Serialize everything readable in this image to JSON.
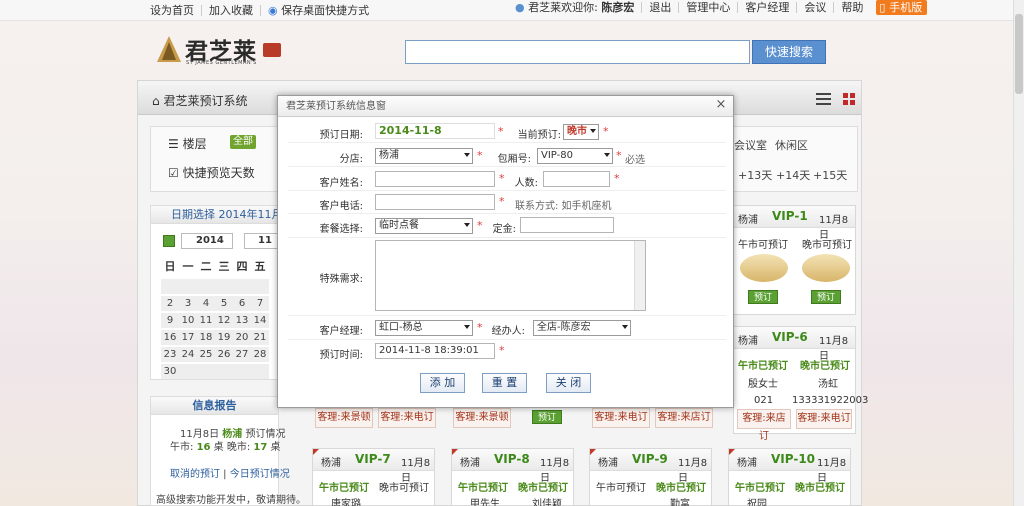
{
  "topbar": {
    "set_home": "设为首页",
    "add_fav": "加入收藏",
    "save_shortcut": "保存桌面快捷方式",
    "welcome": "君芝莱欢迎你:",
    "user": "陈彦宏",
    "logout": "退出",
    "admin": "管理中心",
    "customer_manager": "客户经理",
    "meeting": "会议",
    "help": "帮助",
    "mobile": "手机版"
  },
  "header": {
    "logo_text": "君芝莱",
    "logo_sub": "ST JAMES GENTLEMAN'S",
    "search_value": "",
    "search_button": "快速搜索"
  },
  "nav": {
    "title": "君芝莱预订系统"
  },
  "filter": {
    "floor_label": "楼层",
    "all_badge": "全部",
    "quick_days_label": "快捷预览天数",
    "area_items": [
      "会议室",
      "休闲区"
    ],
    "day_items": [
      "+13天",
      "+14天",
      "+15天"
    ]
  },
  "calendar": {
    "title": "日期选择 2014年11月8日",
    "year": "2014",
    "month": "11",
    "weekdays": [
      "日",
      "一",
      "二",
      "三",
      "四",
      "五"
    ],
    "rows": [
      [
        "",
        "",
        "",
        "",
        "",
        ""
      ],
      [
        "2",
        "3",
        "4",
        "5",
        "6",
        "7"
      ],
      [
        "9",
        "10",
        "11",
        "12",
        "13",
        "14"
      ],
      [
        "16",
        "17",
        "18",
        "19",
        "20",
        "21"
      ],
      [
        "23",
        "24",
        "25",
        "26",
        "27",
        "28"
      ],
      [
        "30",
        "",
        "",
        "",
        "",
        ""
      ]
    ]
  },
  "info": {
    "title": "信息报告",
    "line1_date": "11月8日",
    "line1_branch": "杨浦",
    "line1_suffix": "预订情况",
    "lunch_label": "午市:",
    "lunch_count": "16",
    "table_unit1": "桌",
    "dinner_label": "晚市:",
    "dinner_count": "17",
    "table_unit2": "桌",
    "cancelled_link": "取消的预订",
    "today_link": "今日预订情况",
    "advanced": "高级搜索功能开发中，敬请期待。"
  },
  "cards": [
    {
      "name": "VIP-1",
      "date": "11月8日",
      "loc": "杨浦",
      "lunch": "午市可预订",
      "dinner": "晚市可预订",
      "book1": "预订",
      "book2": "预订"
    },
    {
      "name": "VIP-6",
      "date": "11月8日",
      "loc": "杨浦",
      "lunch": "午市已预订",
      "dinner": "晚市已预订",
      "lunch_guest": "殷女士",
      "dinner_guest": "汤虹",
      "lunch_phone": "021",
      "dinner_phone": "133331922003",
      "foot1": "客理:来店订",
      "foot2": "客理:来电订"
    },
    {
      "name": "VIP-7",
      "date": "11月8日",
      "loc": "杨浦",
      "lunch": "午市已预订",
      "dinner": "晚市可预订",
      "lunch_guest": "唐家璐"
    },
    {
      "name": "VIP-8",
      "date": "11月8日",
      "loc": "杨浦",
      "lunch": "午市已预订",
      "dinner": "晚市已预订",
      "lunch_guest": "甲先生",
      "dinner_guest": "刘佳颖"
    },
    {
      "name": "VIP-9",
      "date": "11月8日",
      "loc": "杨浦",
      "lunch": "午市可预订",
      "dinner": "晚市已预订",
      "dinner_guest": "勤富"
    },
    {
      "name": "VIP-10",
      "date": "11月8日",
      "loc": "杨浦",
      "lunch": "午市已预订",
      "dinner": "晚市已预订",
      "lunch_guest": "祝园"
    }
  ],
  "row2_footers": [
    "客理:来景顿",
    "客理:来电订",
    "客理:来景顿",
    "预订",
    "客理:来电订",
    "客理:来店订",
    "客理:来电订"
  ],
  "dialog": {
    "title": "君芝莱预订系统信息窗",
    "close": "×",
    "date_label": "预订日期:",
    "date_value": "2014-11-8",
    "current_label": "当前预订:",
    "current_value": "晚市",
    "branch_label": "分店:",
    "branch_value": "杨浦",
    "room_label": "包厢号:",
    "room_value": "VIP-80",
    "required": "必选",
    "name_label": "客户姓名:",
    "name_value": "",
    "people_label": "人数:",
    "people_value": "",
    "phone_label": "客户电话:",
    "phone_value": "",
    "contact_hint": "联系方式: 如手机座机",
    "meal_label": "套餐选择:",
    "meal_value": "临时点餐",
    "deposit_label": "定金:",
    "deposit_value": "",
    "special_label": "特殊需求:",
    "special_value": "",
    "manager_label": "客户经理:",
    "manager_value": "虹口-杨总",
    "handler_label": "经办人:",
    "handler_value": "全店-陈彦宏",
    "time_label": "预订时间:",
    "time_value": "2014-11-8 18:39:01",
    "add_btn": "添 加",
    "reset_btn": "重 置",
    "close_btn": "关 闭",
    "star": "*"
  },
  "colors": {
    "accent_green": "#4a8a1a",
    "link_blue": "#2e5f9e",
    "search_blue": "#5a8fd0",
    "mobile_orange": "#f27b1e",
    "required_red": "#e03a3a"
  }
}
